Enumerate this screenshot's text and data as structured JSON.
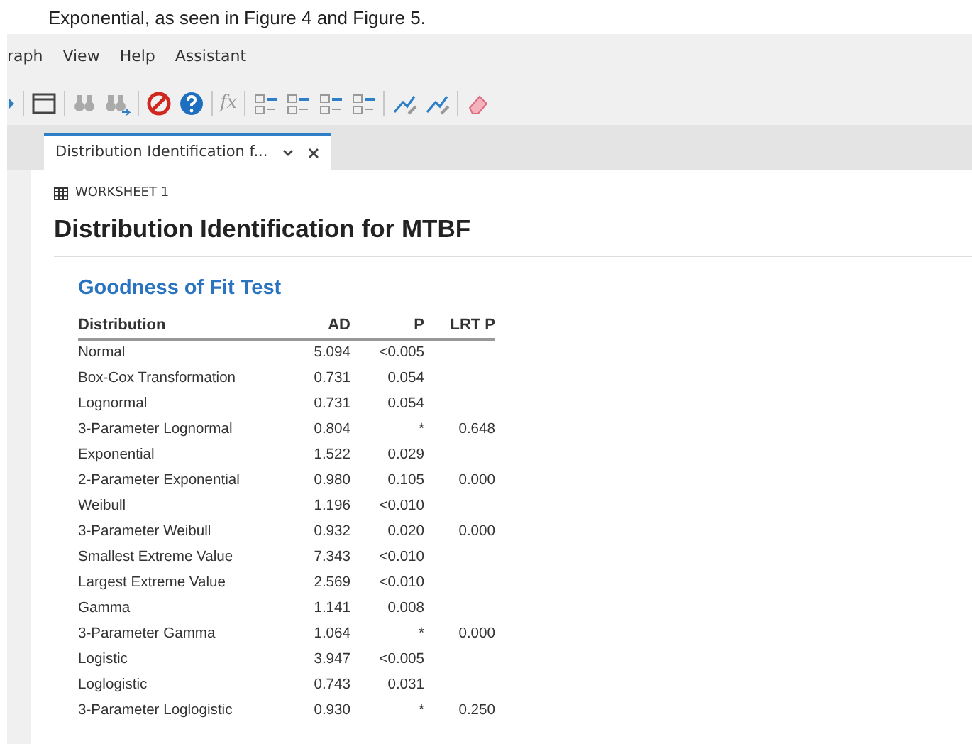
{
  "document_text": "Exponential, as seen in Figure 4 and Figure 5.",
  "menu": [
    "raph",
    "View",
    "Help",
    "Assistant"
  ],
  "toolbar": [
    {
      "kind": "arrow"
    },
    {
      "kind": "sep"
    },
    {
      "kind": "window"
    },
    {
      "kind": "sep"
    },
    {
      "kind": "binoculars"
    },
    {
      "kind": "binoculars-next"
    },
    {
      "kind": "sep"
    },
    {
      "kind": "stop"
    },
    {
      "kind": "help"
    },
    {
      "kind": "sep"
    },
    {
      "kind": "text",
      "label": "fx"
    },
    {
      "kind": "sep"
    },
    {
      "kind": "layout"
    },
    {
      "kind": "layout"
    },
    {
      "kind": "layout"
    },
    {
      "kind": "layout"
    },
    {
      "kind": "sep"
    },
    {
      "kind": "brush"
    },
    {
      "kind": "brush"
    },
    {
      "kind": "sep"
    },
    {
      "kind": "eraser"
    }
  ],
  "tabs": [
    {
      "label": "Distribution Identification f...",
      "selected": true
    }
  ],
  "worksheet": "WORKSHEET 1",
  "title": "Distribution Identification for MTBF",
  "section": "Goodness of Fit Test",
  "table": {
    "columns": [
      "Distribution",
      "AD",
      "P",
      "LRT P"
    ],
    "rows": [
      [
        "Normal",
        "5.094",
        "<0.005",
        ""
      ],
      [
        "Box-Cox Transformation",
        "0.731",
        "0.054",
        ""
      ],
      [
        "Lognormal",
        "0.731",
        "0.054",
        ""
      ],
      [
        "3-Parameter Lognormal",
        "0.804",
        "*",
        "0.648"
      ],
      [
        "Exponential",
        "1.522",
        "0.029",
        ""
      ],
      [
        "2-Parameter Exponential",
        "0.980",
        "0.105",
        "0.000"
      ],
      [
        "Weibull",
        "1.196",
        "<0.010",
        ""
      ],
      [
        "3-Parameter Weibull",
        "0.932",
        "0.020",
        "0.000"
      ],
      [
        "Smallest Extreme Value",
        "7.343",
        "<0.010",
        ""
      ],
      [
        "Largest Extreme Value",
        "2.569",
        "<0.010",
        ""
      ],
      [
        "Gamma",
        "1.141",
        "0.008",
        ""
      ],
      [
        "3-Parameter Gamma",
        "1.064",
        "*",
        "0.000"
      ],
      [
        "Logistic",
        "3.947",
        "<0.005",
        ""
      ],
      [
        "Loglogistic",
        "0.743",
        "0.031",
        ""
      ],
      [
        "3-Parameter Loglogistic",
        "0.930",
        "*",
        "0.250"
      ]
    ]
  }
}
